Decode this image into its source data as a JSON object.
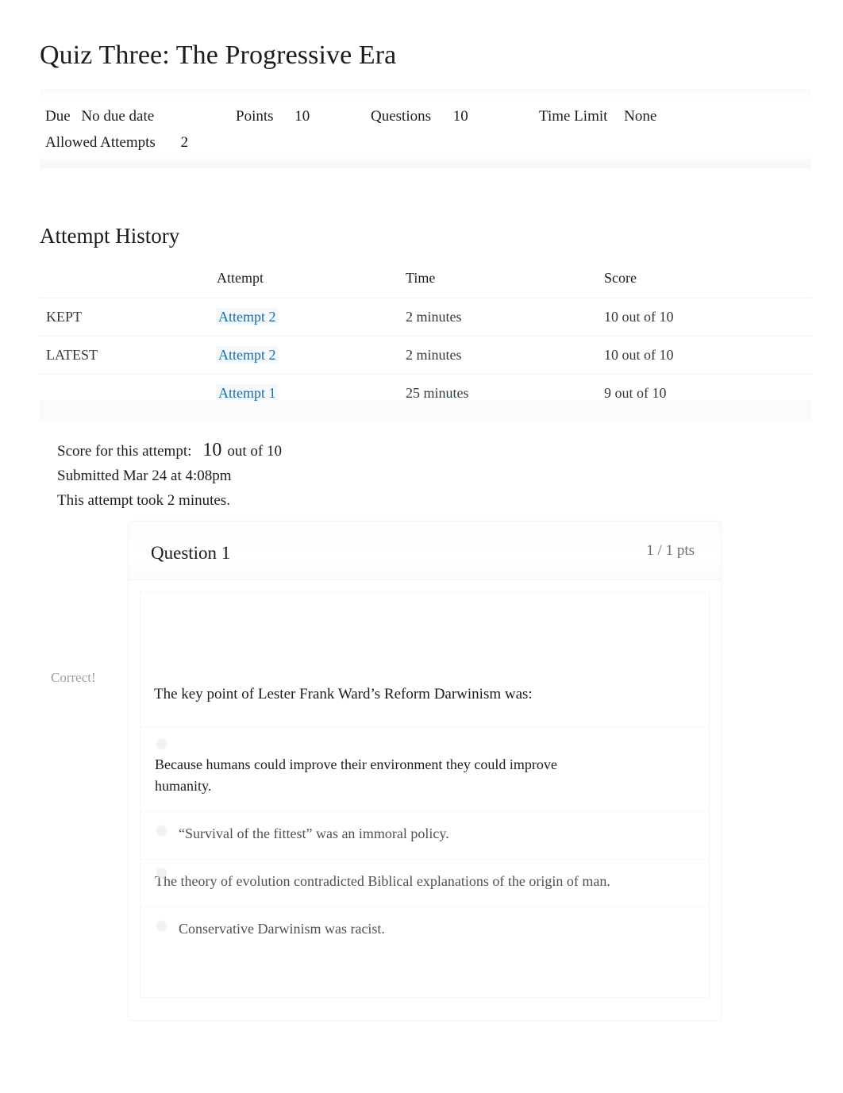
{
  "quiz": {
    "title": "Quiz Three: The Progressive Era",
    "meta": {
      "due_label": "Due",
      "due_value": "No due date",
      "points_label": "Points",
      "points_value": "10",
      "questions_label": "Questions",
      "questions_value": "10",
      "time_limit_label": "Time Limit",
      "time_limit_value": "None",
      "allowed_attempts_label": "Allowed Attempts",
      "allowed_attempts_value": "2"
    }
  },
  "attempt_history": {
    "heading": "Attempt History",
    "columns": {
      "status": "",
      "attempt": "Attempt",
      "time": "Time",
      "score": "Score"
    },
    "rows": [
      {
        "status": "KEPT",
        "attempt": "Attempt 2",
        "time": "2 minutes",
        "score": "10 out of 10"
      },
      {
        "status": "LATEST",
        "attempt": "Attempt 2",
        "time": "2 minutes",
        "score": "10 out of 10"
      },
      {
        "status": "",
        "attempt": "Attempt 1",
        "time": "25 minutes",
        "score": "9 out of 10"
      }
    ]
  },
  "score_summary": {
    "label": "Score for this attempt:",
    "value": "10",
    "out_of": "out of 10",
    "submitted": "Submitted Mar 24 at 4:08pm",
    "duration": "This attempt took 2 minutes."
  },
  "question": {
    "name": "Question 1",
    "points": "1 / 1 pts",
    "correct_flag": "Correct!",
    "text": "The key point of Lester Frank Ward’s Reform Darwinism was:",
    "answers": [
      {
        "text": "Because humans could improve their environment they could improve humanity.",
        "selected": true
      },
      {
        "text": "“Survival of the fittest” was an immoral policy.",
        "selected": false
      },
      {
        "text": "The theory of evolution contradicted Biblical explanations of the origin of man.",
        "selected": false
      },
      {
        "text": "Conservative Darwinism was racist.",
        "selected": false
      }
    ]
  },
  "colors": {
    "link": "#1a6ea8",
    "text": "#1c1c1c",
    "muted": "#9b9fa2",
    "points_muted": "#6b6f73",
    "band": "#fbfbfc"
  }
}
